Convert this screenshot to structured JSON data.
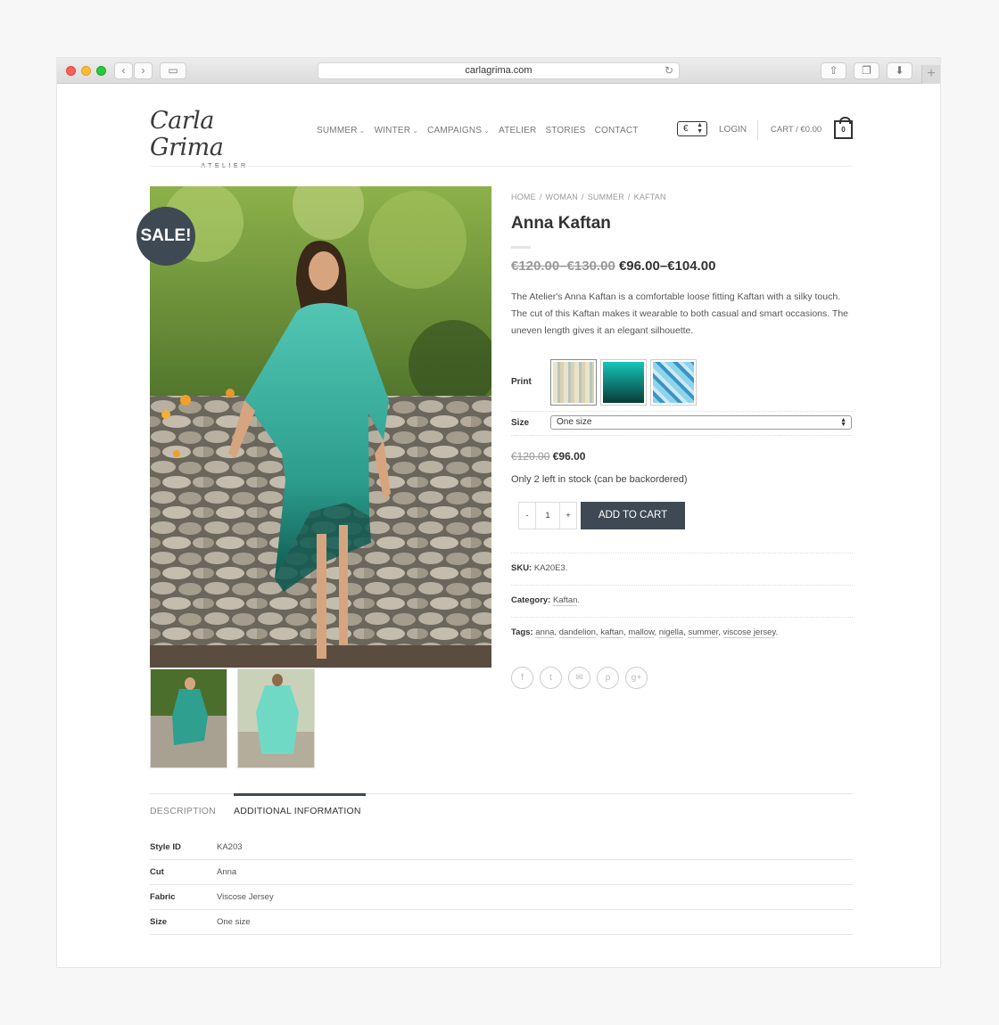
{
  "browser": {
    "url": "carlagrima.com"
  },
  "header": {
    "logo_script": "Carla Grima",
    "logo_sub": "ATELIER",
    "nav": [
      {
        "label": "SUMMER",
        "has_dropdown": true
      },
      {
        "label": "WINTER",
        "has_dropdown": true
      },
      {
        "label": "CAMPAIGNS",
        "has_dropdown": true
      },
      {
        "label": "ATELIER",
        "has_dropdown": false
      },
      {
        "label": "STORIES",
        "has_dropdown": false
      },
      {
        "label": "CONTACT",
        "has_dropdown": false
      }
    ],
    "currency": "€",
    "login": "LOGIN",
    "cart_label": "CART / €0.00",
    "cart_count": "0"
  },
  "product": {
    "sale_badge": "SALE!",
    "breadcrumb": [
      "HOME",
      "/",
      "WOMAN",
      "/",
      "SUMMER",
      "/",
      "KAFTAN"
    ],
    "title": "Anna Kaftan",
    "price_old": "€120.00–€130.00",
    "price_new": "€96.00–€104.00",
    "description": "The Atelier's Anna Kaftan is a comfortable loose fitting Kaftan with a silky touch. The cut of this Kaftan makes it wearable to both casual and smart occasions. The uneven length gives it an elegant silhouette.",
    "print_label": "Print",
    "size_label": "Size",
    "size_value": "One size",
    "variation_price_old": "€120.00",
    "variation_price_new": "€96.00",
    "stock": "Only 2 left in stock (can be backordered)",
    "qty_minus": "-",
    "qty_value": "1",
    "qty_plus": "+",
    "add_to_cart": "ADD TO CART",
    "sku_label": "SKU:",
    "sku_value": "KA20E3.",
    "category_label": "Category:",
    "category_value": "Kaftan",
    "tags_label": "Tags:",
    "tags": [
      "anna",
      "dandelion",
      "kaftan",
      "mallow",
      "nigella",
      "summer",
      "viscose jersey"
    ],
    "share_icons": [
      "facebook-icon",
      "twitter-icon",
      "email-icon",
      "pinterest-icon",
      "googleplus-icon"
    ],
    "share_glyphs": [
      "f",
      "t",
      "✉",
      "p",
      "g+"
    ]
  },
  "tabs": {
    "description": "DESCRIPTION",
    "additional": "ADDITIONAL INFORMATION"
  },
  "attributes": [
    {
      "key": "Style ID",
      "value": "KA203"
    },
    {
      "key": "Cut",
      "value": "Anna"
    },
    {
      "key": "Fabric",
      "value": "Viscose Jersey"
    },
    {
      "key": "Size",
      "value": "One size"
    }
  ],
  "colors": {
    "accent": "#3e4954",
    "swatch_teal": "#0d9c93"
  }
}
